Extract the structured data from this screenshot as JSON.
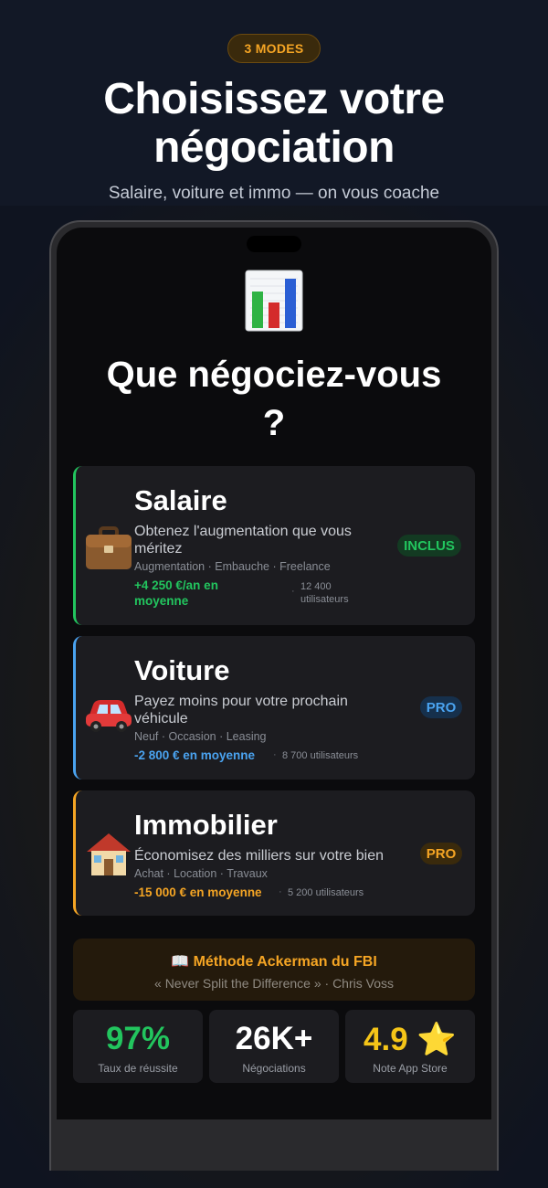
{
  "header": {
    "pill": "3 MODES",
    "title_line1": "Choisissez votre",
    "title_line2": "négociation",
    "subtitle": "Salaire, voiture et immo — on vous coache"
  },
  "screen": {
    "question_line1": "Que négociez-vous",
    "question_line2": "?",
    "icon": "bar-chart-icon"
  },
  "modes": [
    {
      "name": "Salaire",
      "icon": "briefcase-icon",
      "desc_line1": "Obtenez l'augmentation que vous",
      "desc_line2": "méritez",
      "tags": "Augmentation · Embauche · Freelance",
      "gain_line1": "+4 250 €/an en",
      "gain_line2": "moyenne",
      "users_line1": "12 400",
      "users_line2": "utilisateurs",
      "badge": "INCLUS",
      "color": "#22c55e"
    },
    {
      "name": "Voiture",
      "icon": "car-icon",
      "desc_line1": "Payez moins pour votre prochain",
      "desc_line2": "véhicule",
      "tags": "Neuf · Occasion · Leasing",
      "gain": "-2 800 € en moyenne",
      "users": "8 700 utilisateurs",
      "badge": "PRO",
      "color": "#4aa3f0"
    },
    {
      "name": "Immobilier",
      "icon": "house-icon",
      "desc": "Économisez des milliers sur votre bien",
      "tags": "Achat · Location · Travaux",
      "gain": "-15 000 € en moyenne",
      "users": "5 200 utilisateurs",
      "badge": "PRO",
      "color": "#f5a524"
    }
  ],
  "ackerman": {
    "icon": "book-icon",
    "title": "📖 Méthode Ackerman du FBI",
    "quote": "« Never Split the Difference » · Chris Voss"
  },
  "stats": [
    {
      "value": "97%",
      "label": "Taux de réussite",
      "color": "#22c55e"
    },
    {
      "value": "26K+",
      "label": "Négociations",
      "color": "#ffffff"
    },
    {
      "value": "4.9 ⭐",
      "label": "Note App Store",
      "color": "#f5c518"
    }
  ]
}
